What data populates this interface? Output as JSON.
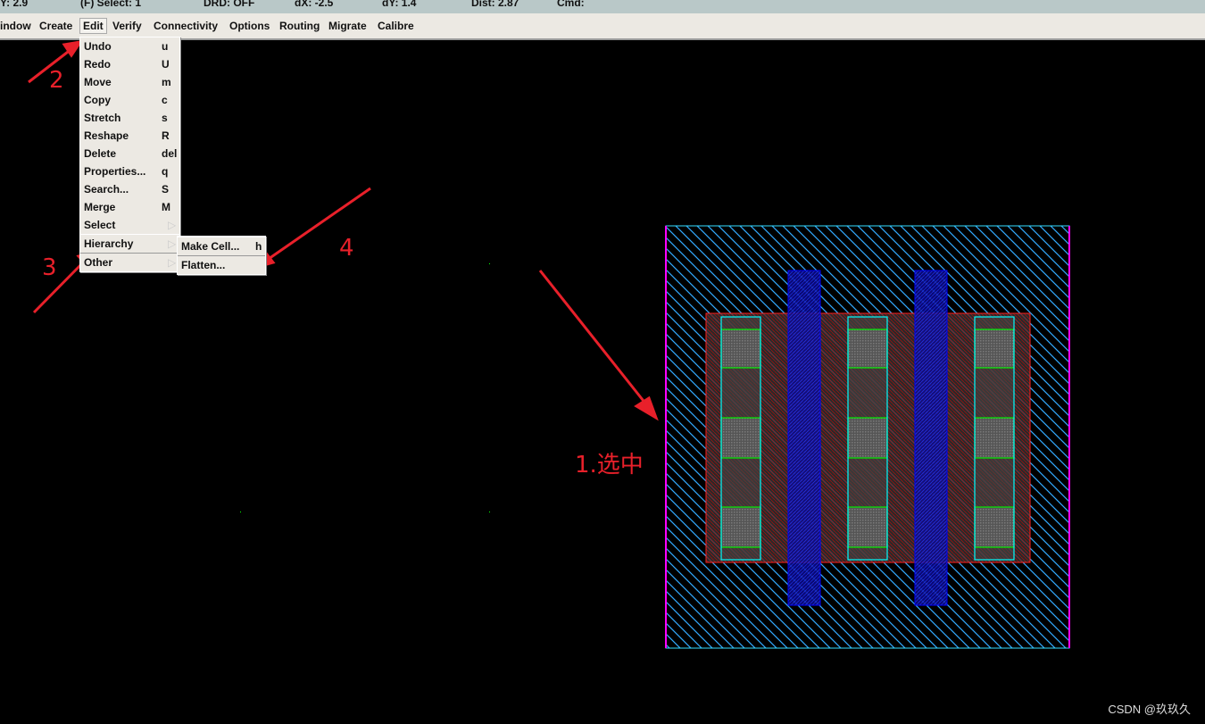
{
  "status": {
    "y": "Y:  2.9",
    "select": "(F) Select: 1",
    "drd": "DRD: OFF",
    "dx": "dX: -2.5",
    "dy": "dY:  1.4",
    "dist": "Dist: 2.87",
    "cmd": "Cmd:"
  },
  "menubar": [
    "indow",
    "Create",
    "Edit",
    "Verify",
    "Connectivity",
    "Options",
    "Routing",
    "Migrate",
    "Calibre"
  ],
  "edit_menu": [
    {
      "label": "Undo",
      "key": "u"
    },
    {
      "label": "Redo",
      "key": "U"
    },
    {
      "label": "Move",
      "key": "m"
    },
    {
      "label": "Copy",
      "key": "c"
    },
    {
      "label": "Stretch",
      "key": "s"
    },
    {
      "label": "Reshape",
      "key": "R"
    },
    {
      "label": "Delete",
      "key": "del"
    },
    {
      "label": "Properties...",
      "key": "q"
    },
    {
      "label": "Search...",
      "key": "S"
    },
    {
      "label": "Merge",
      "key": "M"
    },
    {
      "label": "Select",
      "key": "",
      "submenu": true
    },
    {
      "label": "Hierarchy",
      "key": "",
      "submenu": true
    },
    {
      "label": "Other",
      "key": "",
      "submenu": true
    }
  ],
  "hierarchy_menu": [
    {
      "label": "Make Cell...",
      "key": "h"
    },
    {
      "label": "Flatten...",
      "key": ""
    }
  ],
  "annotations": {
    "a1": "1.选中",
    "a2": "2",
    "a3": "3",
    "a4": "4"
  },
  "watermark": "CSDN @玖玖久",
  "colors": {
    "annotation": "#e8202a",
    "boundary": "#33aaff",
    "poly": "#0000ff",
    "diffusion": "#00ffff",
    "contact": "#00ff00",
    "nwell": "#ff0000",
    "edge": "#ff00ff"
  }
}
